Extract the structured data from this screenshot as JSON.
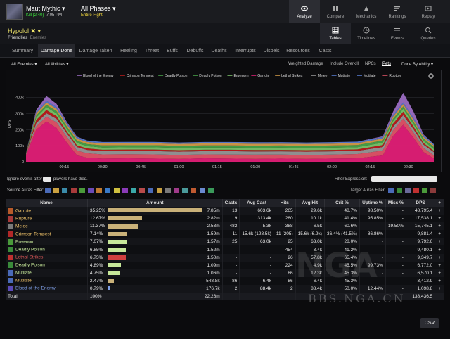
{
  "header": {
    "encounter": "Maut Mythic",
    "result": "Kill (2:40)",
    "time": "7:05 PM",
    "phase": "All Phases",
    "phase_sub": "Entire Fight",
    "nav": [
      {
        "label": "Analyze",
        "icon": "eye-icon"
      },
      {
        "label": "Compare",
        "icon": "compare-icon"
      },
      {
        "label": "Mechanics",
        "icon": "mechanics-icon"
      },
      {
        "label": "Rankings",
        "icon": "rankings-icon"
      },
      {
        "label": "Replay",
        "icon": "replay-icon"
      }
    ]
  },
  "player": {
    "name": "Hypolol",
    "friendlies": "Friendlies",
    "enemies": "Enemies"
  },
  "views": [
    {
      "label": "Tables",
      "icon": "table-icon"
    },
    {
      "label": "Timelines",
      "icon": "clock-icon"
    },
    {
      "label": "Events",
      "icon": "list-icon"
    },
    {
      "label": "Queries",
      "icon": "query-icon"
    }
  ],
  "tabs": [
    "Summary",
    "Damage Done",
    "Damage Taken",
    "Healing",
    "Threat",
    "Buffs",
    "Debuffs",
    "Deaths",
    "Interrupts",
    "Dispels",
    "Resources",
    "Casts"
  ],
  "filters": {
    "enemies": "All Enemies",
    "abilities": "All Abilities",
    "options": [
      "Weighted Damage",
      "Include Overkill",
      "NPCs",
      "Pets"
    ],
    "group": "Done By Ability"
  },
  "aura": {
    "ignore_prefix": "Ignore events after",
    "ignore_suffix": "players have died.",
    "filter_expr": "Filter Expression:",
    "source_label": "Source Auras Filter:",
    "target_label": "Target Auras Filter:"
  },
  "chart_data": {
    "type": "area",
    "ylabel": "DPS",
    "yticks": [
      "400k",
      "300k",
      "200k",
      "100k",
      "0"
    ],
    "ylim": [
      0,
      420000
    ],
    "xticks": [
      "00:15",
      "00:30",
      "00:45",
      "01:00",
      "01:15",
      "01:30",
      "01:45",
      "02:00",
      "02:15",
      "02:30"
    ],
    "x_seconds": [
      0,
      4,
      8,
      12,
      16,
      20,
      24,
      30,
      40,
      50,
      60,
      70,
      80,
      90,
      100,
      110,
      120,
      130,
      140,
      144,
      148,
      152,
      156,
      160
    ],
    "legend": [
      "Blood of the Enemy",
      "Crimson Tempest",
      "Deadly Poison",
      "Deadly Poison",
      "Envenom",
      "Garrote",
      "Lethal Strikes",
      "Melee",
      "Mutilate",
      "Mutilate",
      "Rupture"
    ],
    "series": [
      {
        "name": "Garrote",
        "color": "#e8207a",
        "values": [
          40000,
          200000,
          250000,
          210000,
          120000,
          40000,
          25000,
          20000,
          22000,
          20000,
          18000,
          22000,
          20000,
          18000,
          20000,
          18000,
          20000,
          22000,
          40000,
          160000,
          230000,
          150000,
          60000,
          20000
        ]
      },
      {
        "name": "Rupture",
        "color": "#e8566a",
        "values": [
          5000,
          20000,
          30000,
          35000,
          35000,
          30000,
          28000,
          26000,
          25000,
          26000,
          25000,
          24000,
          25000,
          26000,
          25000,
          24000,
          25000,
          26000,
          30000,
          35000,
          38000,
          32000,
          25000,
          20000
        ]
      },
      {
        "name": "Melee",
        "color": "#9b9b9b",
        "values": [
          5000,
          20000,
          22000,
          22000,
          22000,
          22000,
          21000,
          20000,
          20000,
          21000,
          20000,
          20000,
          21000,
          20000,
          20000,
          21000,
          20000,
          20000,
          22000,
          22000,
          22000,
          22000,
          21000,
          20000
        ]
      },
      {
        "name": "Crimson Tempest",
        "color": "#c21c1c",
        "values": [
          3000,
          20000,
          20000,
          16000,
          12000,
          10000,
          9000,
          9000,
          9000,
          9000,
          9000,
          9000,
          9000,
          9000,
          9000,
          9000,
          9000,
          9000,
          12000,
          20000,
          22000,
          16000,
          10000,
          8000
        ]
      },
      {
        "name": "Envenom",
        "color": "#7ec96b",
        "values": [
          0,
          15000,
          18000,
          18000,
          16000,
          15000,
          14000,
          14000,
          14000,
          14000,
          14000,
          14000,
          14000,
          14000,
          14000,
          14000,
          14000,
          14000,
          15000,
          16000,
          18000,
          16000,
          14000,
          12000
        ]
      },
      {
        "name": "Deadly Poison",
        "color": "#4aa84a",
        "values": [
          2000,
          13000,
          14000,
          14000,
          14000,
          14000,
          13000,
          13000,
          13000,
          13000,
          13000,
          13000,
          13000,
          13000,
          13000,
          13000,
          13000,
          13000,
          13000,
          14000,
          14000,
          14000,
          13000,
          12000
        ]
      },
      {
        "name": "Lethal Strikes",
        "color": "#d9a04a",
        "values": [
          0,
          14000,
          15000,
          15000,
          14000,
          13000,
          13000,
          12000,
          12000,
          12000,
          12000,
          12000,
          12000,
          12000,
          12000,
          12000,
          12000,
          12000,
          13000,
          14000,
          15000,
          14000,
          12000,
          10000
        ]
      },
      {
        "name": "Mutilate",
        "color": "#5a7fd6",
        "values": [
          2000,
          10000,
          10000,
          10000,
          10000,
          10000,
          9000,
          9000,
          9000,
          9000,
          9000,
          9000,
          9000,
          9000,
          9000,
          9000,
          9000,
          9000,
          9000,
          10000,
          10000,
          10000,
          9000,
          8000
        ]
      },
      {
        "name": "Blood of the Enemy",
        "color": "#a070c8",
        "values": [
          0,
          10000,
          30000,
          20000,
          5000,
          2000,
          0,
          0,
          0,
          0,
          0,
          0,
          0,
          0,
          0,
          0,
          0,
          0,
          5000,
          20000,
          60000,
          40000,
          5000,
          0
        ]
      }
    ]
  },
  "table": {
    "columns": [
      "Name",
      "Amount",
      "Casts",
      "Avg Cast",
      "Hits",
      "Avg Hit",
      "Crit %",
      "Uptime %",
      "Miss %",
      "DPS",
      "+"
    ],
    "rows": [
      {
        "name": "Garrote",
        "pct": "35.25%",
        "frac": 1.0,
        "bar_color": "#c9b179",
        "amount": "7.85m",
        "casts": "13",
        "avg_cast": "603.6k",
        "hits": "265",
        "avg_hit": "29.6k",
        "crit": "48.7%",
        "uptime": "98.50%",
        "miss": "-",
        "dps": "48,795.4",
        "icon_color": "#b85a2a",
        "text_color": "#f0c36a"
      },
      {
        "name": "Rupture",
        "pct": "12.67%",
        "frac": 0.36,
        "bar_color": "#c9b179",
        "amount": "2.82m",
        "casts": "9",
        "avg_cast": "313.4k",
        "hits": "280",
        "avg_hit": "10.1k",
        "crit": "41.4%",
        "uptime": "95.85%",
        "miss": "-",
        "dps": "17,538.1",
        "icon_color": "#a83a3a",
        "text_color": "#f0c36a"
      },
      {
        "name": "Melee",
        "pct": "11.37%",
        "frac": 0.32,
        "bar_color": "#c9b179",
        "amount": "2.53m",
        "casts": "482",
        "avg_cast": "5.3k",
        "hits": "388",
        "avg_hit": "6.5k",
        "crit": "60.6%",
        "uptime": "-",
        "miss": "19.50%",
        "dps": "15,745.1",
        "icon_color": "#7a7a7a",
        "text_color": "#f0c36a"
      },
      {
        "name": "Crimson Tempest",
        "pct": "7.14%",
        "frac": 0.2,
        "bar_color": "#c9b179",
        "amount": "1.59m",
        "casts": "11",
        "avg_cast": "15.6k (128.5k)",
        "hits": "11 (205)",
        "avg_hit": "15.6k (6.9k)",
        "crit": "36.4% (41.5%)",
        "uptime": "86.86%",
        "miss": "-",
        "dps": "9,881.4",
        "icon_color": "#b02828",
        "text_color": "#f0c36a"
      },
      {
        "name": "Envenom",
        "pct": "7.07%",
        "frac": 0.2,
        "bar_color": "#c7e89a",
        "amount": "1.57m",
        "casts": "25",
        "avg_cast": "63.0k",
        "hits": "25",
        "avg_hit": "63.0k",
        "crit": "28.0%",
        "uptime": "-",
        "miss": "-",
        "dps": "9,792.6",
        "icon_color": "#4a9a3a",
        "text_color": "#c7e89a"
      },
      {
        "name": "Deadly Poison",
        "pct": "6.85%",
        "frac": 0.19,
        "bar_color": "#c7e89a",
        "amount": "1.52m",
        "casts": "-",
        "avg_cast": "-",
        "hits": "454",
        "avg_hit": "3.4k",
        "crit": "41.2%",
        "uptime": "-",
        "miss": "-",
        "dps": "9,480.1",
        "icon_color": "#3a8a3a",
        "text_color": "#c7e89a"
      },
      {
        "name": "Lethal Strikes",
        "pct": "6.75%",
        "frac": 0.19,
        "bar_color": "#d04040",
        "amount": "1.50m",
        "casts": "-",
        "avg_cast": "-",
        "hits": "26",
        "avg_hit": "57.8k",
        "crit": "65.4%",
        "uptime": "-",
        "miss": "-",
        "dps": "9,349.7",
        "icon_color": "#c03030",
        "text_color": "#e85a5a"
      },
      {
        "name": "Deadly Poison",
        "pct": "4.89%",
        "frac": 0.14,
        "bar_color": "#c7e89a",
        "amount": "1.09m",
        "casts": "-",
        "avg_cast": "-",
        "hits": "224",
        "avg_hit": "4.9k",
        "crit": "45.5%",
        "uptime": "99.73%",
        "miss": "-",
        "dps": "6,772.0",
        "icon_color": "#3a8a3a",
        "text_color": "#c7e89a"
      },
      {
        "name": "Mutilate",
        "pct": "4.75%",
        "frac": 0.13,
        "bar_color": "#c7e89a",
        "amount": "1.06m",
        "casts": "-",
        "avg_cast": "-",
        "hits": "86",
        "avg_hit": "12.3k",
        "crit": "45.3%",
        "uptime": "-",
        "miss": "-",
        "dps": "6,570.1",
        "icon_color": "#4a6ab8",
        "text_color": "#c7e89a"
      },
      {
        "name": "Mutilate",
        "pct": "2.47%",
        "frac": 0.07,
        "bar_color": "#c9b179",
        "amount": "548.8k",
        "casts": "86",
        "avg_cast": "6.4k",
        "hits": "86",
        "avg_hit": "6.4k",
        "crit": "45.3%",
        "uptime": "-",
        "miss": "-",
        "dps": "3,412.9",
        "icon_color": "#4a6ab8",
        "text_color": "#f0c36a"
      },
      {
        "name": "Blood of the Enemy",
        "pct": "0.79%",
        "frac": 0.02,
        "bar_color": "#7fa0e8",
        "amount": "176.7k",
        "casts": "2",
        "avg_cast": "88.4k",
        "hits": "2",
        "avg_hit": "88.4k",
        "crit": "50.0%",
        "uptime": "12.44%",
        "miss": "-",
        "dps": "1,098.8",
        "icon_color": "#5a4ab8",
        "text_color": "#7fa0e8"
      }
    ],
    "total": {
      "name": "Total",
      "pct": "100%",
      "amount": "22.26m",
      "dps": "138,436.5"
    }
  },
  "csv_label": "CSV",
  "watermark": "BBS.NGA.CN"
}
